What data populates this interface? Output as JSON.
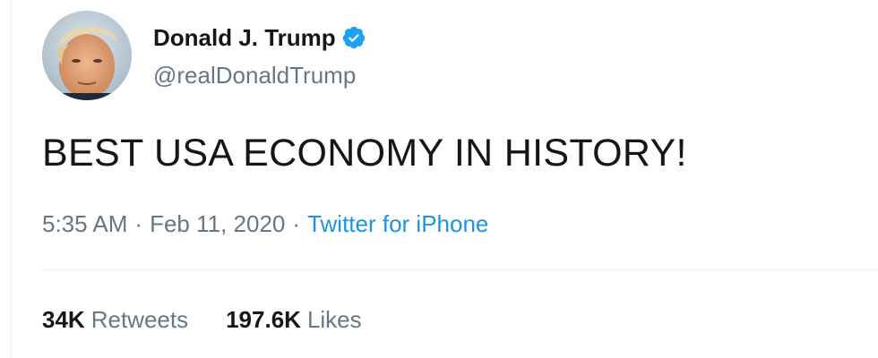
{
  "user": {
    "display_name": "Donald J. Trump",
    "handle": "@realDonaldTrump",
    "verified_icon": "verified-badge-icon",
    "avatar_icon": "profile-photo"
  },
  "tweet": {
    "text": "BEST USA ECONOMY IN HISTORY!",
    "time": "5:35 AM",
    "separator": "·",
    "date": "Feb 11, 2020",
    "source": "Twitter for iPhone"
  },
  "stats": {
    "retweets_count": "34K",
    "retweets_label": "Retweets",
    "likes_count": "197.6K",
    "likes_label": "Likes"
  },
  "colors": {
    "accent": "#1b95e0",
    "verified": "#1da1f2",
    "secondary_text": "#657786",
    "primary_text": "#14171a",
    "divider": "#e6ecf0"
  }
}
